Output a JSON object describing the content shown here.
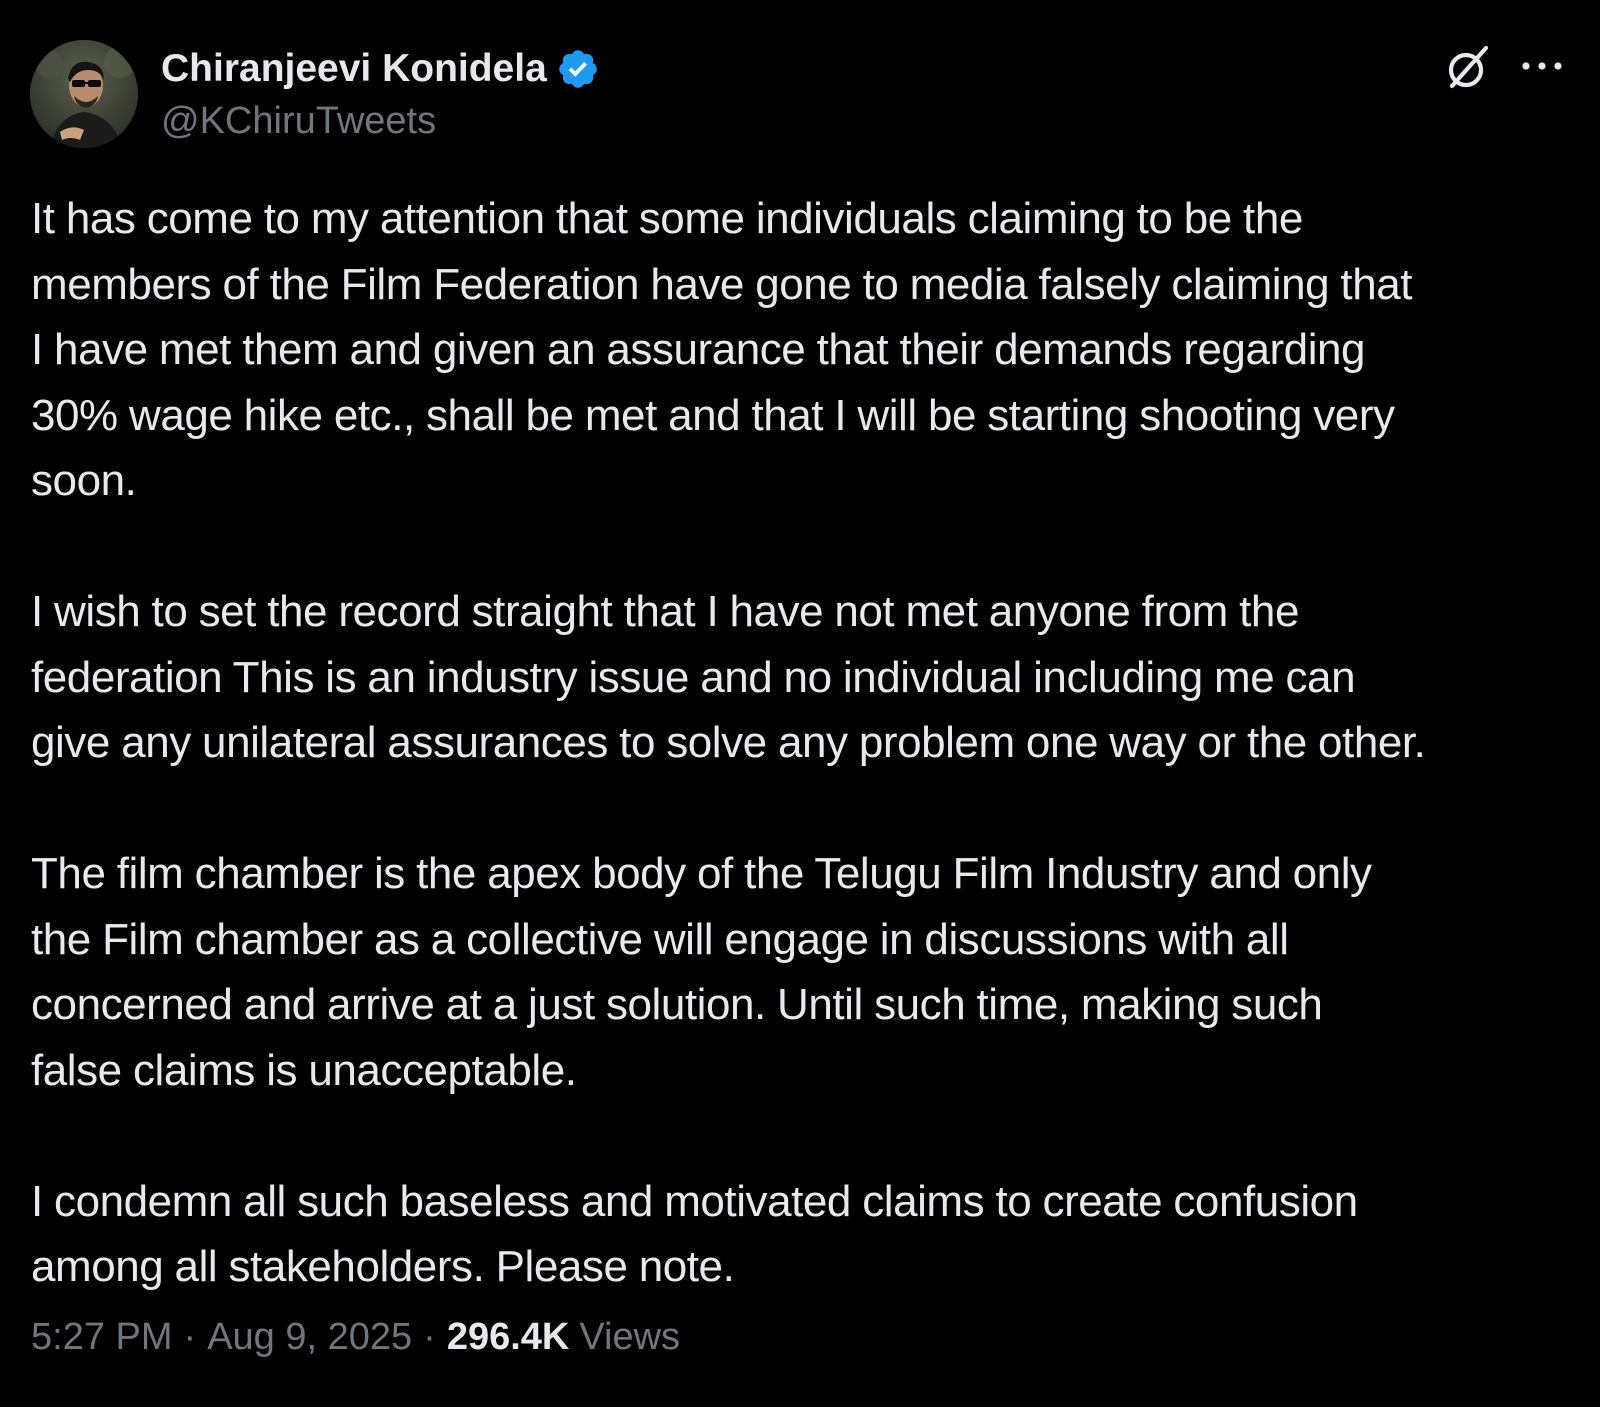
{
  "author": {
    "display_name": "Chiranjeevi Konidela",
    "handle": "@KChiruTweets",
    "verified": true,
    "avatar_icon": "profile-photo"
  },
  "actions": {
    "grok_icon": "grok-icon",
    "more_icon": "more-options-icon"
  },
  "tweet": {
    "paragraphs": [
      "It has come to my attention that some individuals claiming to be the\nmembers of the Film Federation have gone to media falsely claiming that\nI have met them and given an assurance that their demands regarding\n30% wage hike etc.,  shall be met and that I will be starting shooting very\nsoon.",
      "I wish to set the record straight that I have not met anyone from the\nfederation This is an industry issue and no individual including me can\ngive any unilateral assurances to solve any problem one way or the other.",
      "The film chamber is the apex body of the Telugu Film Industry and only\nthe Film chamber as a collective will engage in discussions with all\nconcerned and arrive at a just solution. Until such time, making such\nfalse claims is unacceptable.",
      "I condemn all such baseless and motivated claims to create confusion\namong all stakeholders. Please note."
    ]
  },
  "meta": {
    "time": "5:27 PM",
    "separator": "·",
    "date": "Aug 9, 2025",
    "views_count": "296.4K",
    "views_label": "Views"
  },
  "colors": {
    "background": "#000000",
    "text_primary": "#e7e9ea",
    "text_secondary": "#71767b",
    "verified_blue": "#1d9bf0"
  }
}
